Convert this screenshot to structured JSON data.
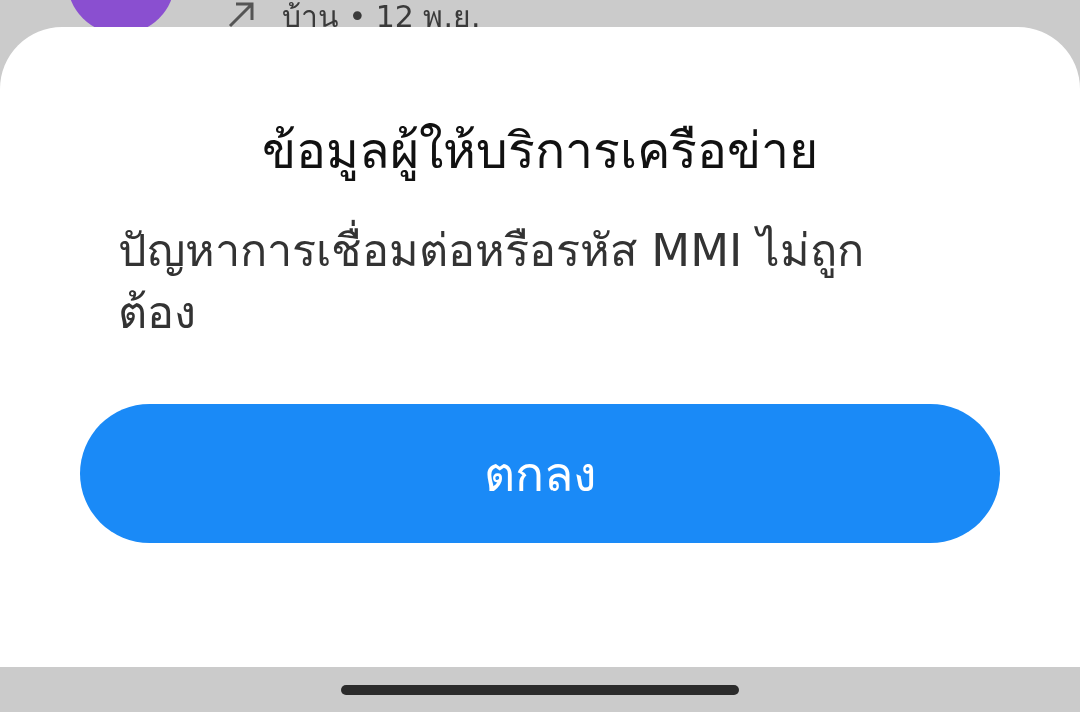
{
  "background_item": {
    "subtitle": "บ้าน • 12 พ.ย."
  },
  "dialog": {
    "title": "ข้อมูลผู้ให้บริการเครือข่าย",
    "message": "ปัญหาการเชื่อมต่อหรือรหัส MMI ไม่ถูกต้อง",
    "button": "ตกลง"
  }
}
